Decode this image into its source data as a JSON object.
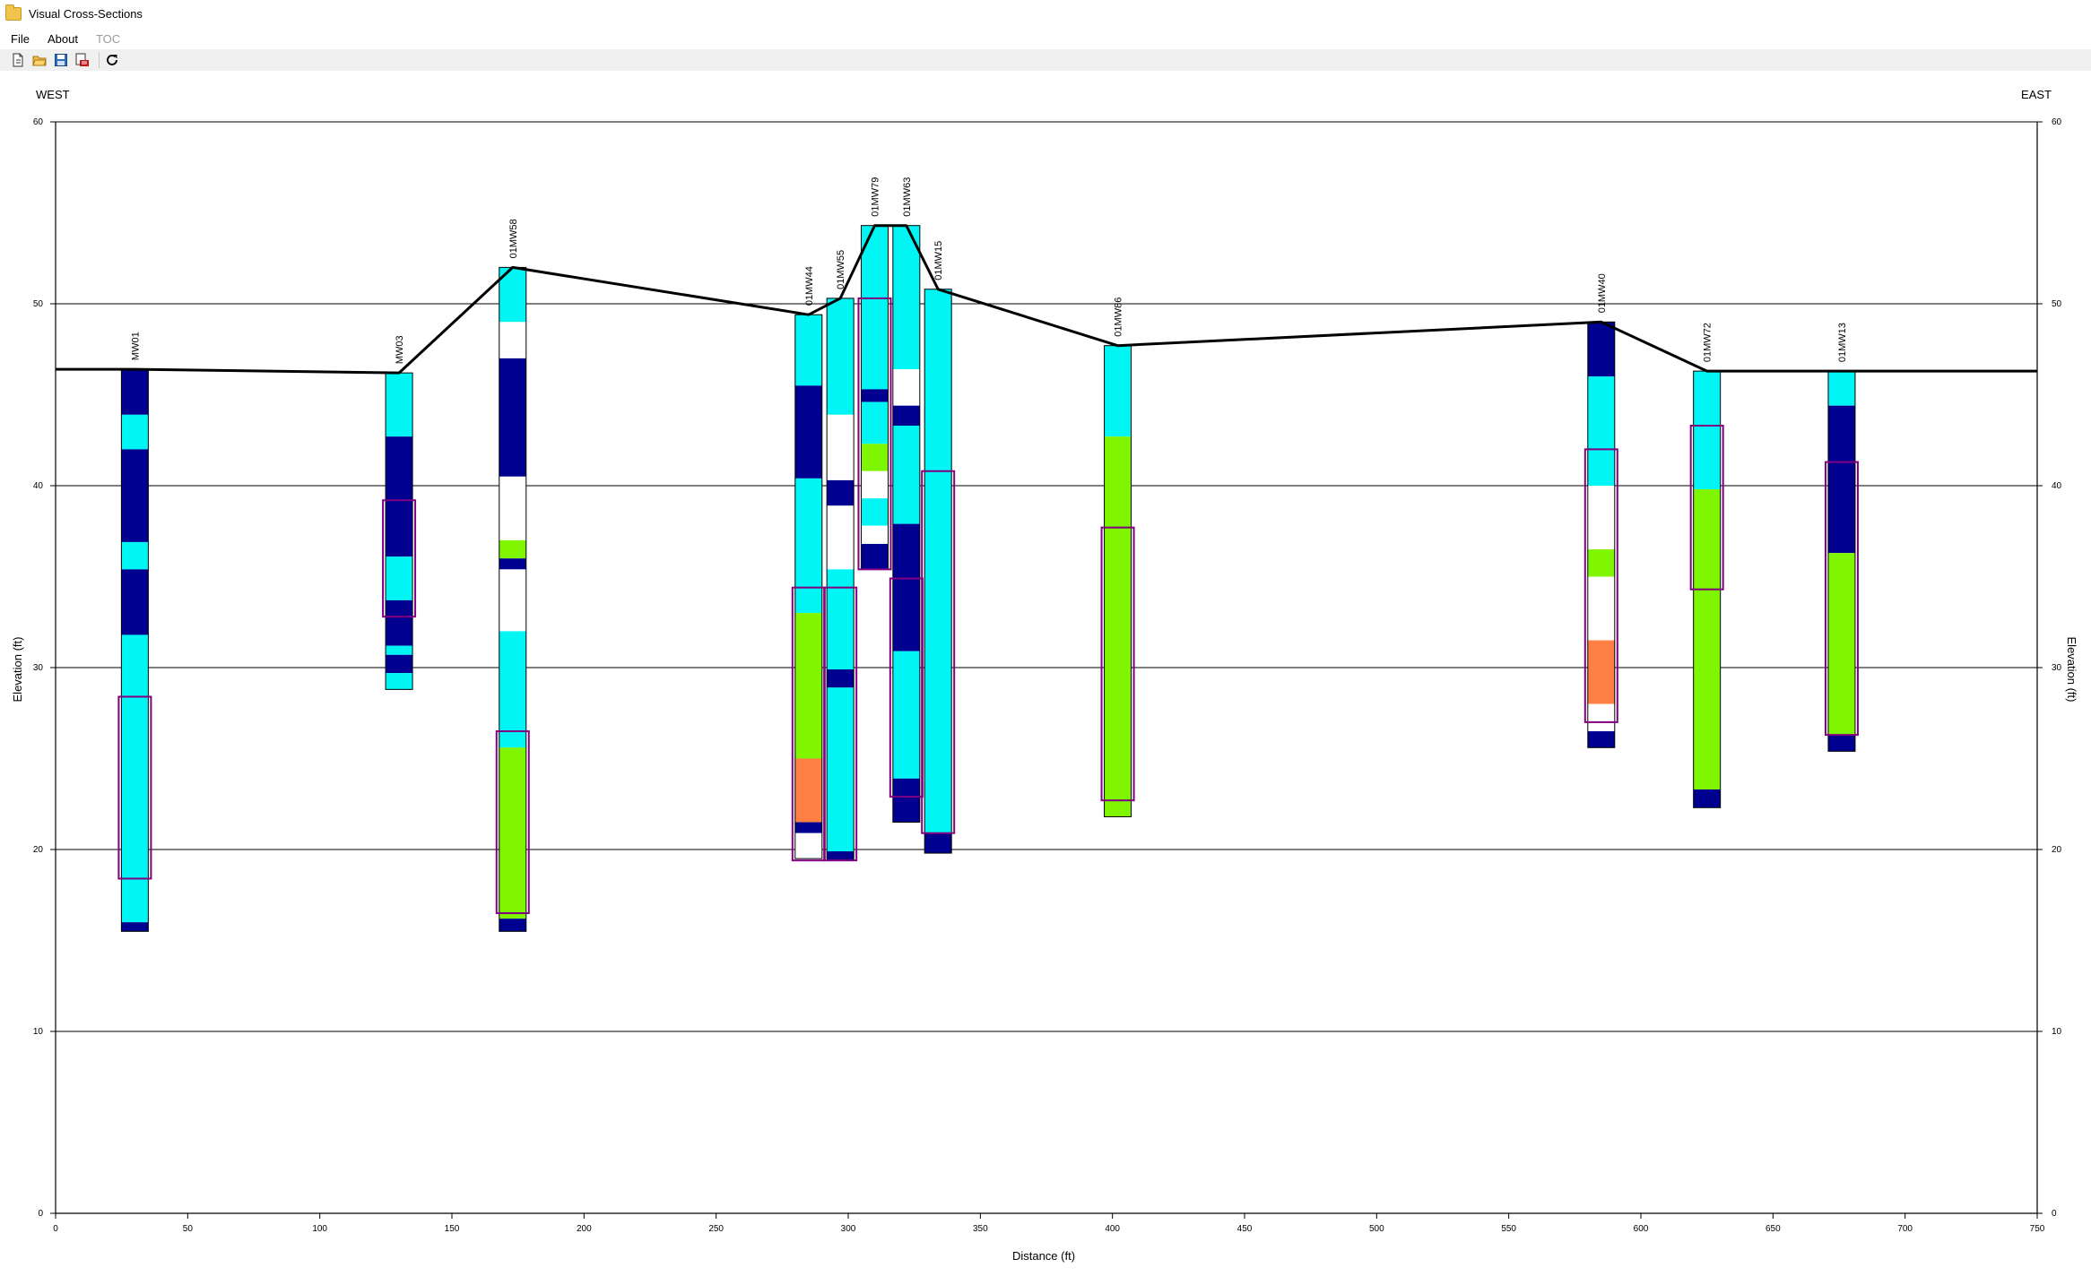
{
  "window": {
    "title": "Visual Cross-Sections"
  },
  "menu": {
    "file": "File",
    "about": "About",
    "toc": "TOC"
  },
  "toolbar": {
    "new_icon": "new-document-icon",
    "open_icon": "open-folder-icon",
    "save_icon": "save-icon",
    "pdf_icon": "pdf-export-icon",
    "refresh_icon": "refresh-icon"
  },
  "labels": {
    "west": "WEST",
    "east": "EAST"
  },
  "colors": {
    "cyan": "#00f5f5",
    "navy": "#000090",
    "green": "#7ff500",
    "orange": "#ff7f45",
    "white": "#ffffff",
    "screen": "#800080",
    "surface": "#000000"
  },
  "chart_data": {
    "type": "cross-section",
    "xlabel": "Distance (ft)",
    "ylabel": "Elevation (ft)",
    "ylabel_right": "Elevation (ft)",
    "xlim": [
      0,
      750
    ],
    "ylim": [
      0,
      60
    ],
    "xticks": [
      0,
      50,
      100,
      150,
      200,
      250,
      300,
      350,
      400,
      450,
      500,
      550,
      600,
      650,
      700,
      750
    ],
    "yticks": [
      0,
      10,
      20,
      30,
      40,
      50,
      60
    ],
    "grid": "horizontal",
    "surface": [
      [
        0,
        46.4
      ],
      [
        30,
        46.4
      ],
      [
        130,
        46.2
      ],
      [
        173,
        52
      ],
      [
        285,
        49.4
      ],
      [
        297,
        50.3
      ],
      [
        310,
        54.3
      ],
      [
        322,
        54.3
      ],
      [
        334,
        50.8
      ],
      [
        402,
        47.7
      ],
      [
        585,
        49
      ],
      [
        625,
        46.3
      ],
      [
        676,
        46.3
      ],
      [
        750,
        46.3
      ]
    ],
    "wells": [
      {
        "name": "MW01",
        "x": 30,
        "top": 46.4,
        "layers": [
          [
            46.4,
            43.9,
            "navy"
          ],
          [
            43.9,
            42,
            "cyan"
          ],
          [
            42,
            36.9,
            "navy"
          ],
          [
            36.9,
            35.4,
            "cyan"
          ],
          [
            35.4,
            31.8,
            "navy"
          ],
          [
            31.8,
            16,
            "cyan"
          ],
          [
            16,
            15.5,
            "navy"
          ]
        ],
        "screen": [
          28.4,
          18.4
        ]
      },
      {
        "name": "MW03",
        "x": 130,
        "top": 46.2,
        "layers": [
          [
            46.2,
            42.7,
            "cyan"
          ],
          [
            42.7,
            36.1,
            "navy"
          ],
          [
            36.1,
            33.7,
            "cyan"
          ],
          [
            33.7,
            31.2,
            "navy"
          ],
          [
            31.2,
            30.7,
            "cyan"
          ],
          [
            30.7,
            29.7,
            "navy"
          ],
          [
            29.7,
            28.8,
            "cyan"
          ]
        ],
        "screen": [
          39.2,
          32.8
        ]
      },
      {
        "name": "01MW58",
        "x": 173,
        "top": 52,
        "layers": [
          [
            52,
            49,
            "cyan"
          ],
          [
            49,
            47,
            "white"
          ],
          [
            47,
            40.5,
            "navy"
          ],
          [
            40.5,
            37,
            "white"
          ],
          [
            37,
            36,
            "green"
          ],
          [
            36,
            35.4,
            "navy"
          ],
          [
            35.4,
            32,
            "white"
          ],
          [
            32,
            25.6,
            "cyan"
          ],
          [
            25.6,
            16.2,
            "green"
          ],
          [
            16.2,
            15.5,
            "navy"
          ]
        ],
        "screen": [
          26.5,
          16.5
        ]
      },
      {
        "name": "01MW44",
        "x": 285,
        "top": 49.4,
        "layers": [
          [
            49.4,
            45.5,
            "cyan"
          ],
          [
            45.5,
            40.4,
            "navy"
          ],
          [
            40.4,
            33,
            "cyan"
          ],
          [
            33,
            25,
            "green"
          ],
          [
            25,
            21.5,
            "orange"
          ],
          [
            21.5,
            20.9,
            "navy"
          ],
          [
            20.9,
            19.5,
            "white"
          ]
        ],
        "screen": [
          34.4,
          19.4
        ]
      },
      {
        "name": "01MW55",
        "x": 297,
        "top": 50.3,
        "layers": [
          [
            50.3,
            43.9,
            "cyan"
          ],
          [
            43.9,
            40.3,
            "white"
          ],
          [
            40.3,
            38.9,
            "navy"
          ],
          [
            38.9,
            35.4,
            "white"
          ],
          [
            35.4,
            29.9,
            "cyan"
          ],
          [
            29.9,
            28.9,
            "navy"
          ],
          [
            28.9,
            19.9,
            "cyan"
          ],
          [
            19.9,
            19.4,
            "navy"
          ]
        ],
        "screen": [
          34.4,
          19.4
        ]
      },
      {
        "name": "01MW79",
        "x": 310,
        "top": 54.3,
        "layers": [
          [
            54.3,
            45.3,
            "cyan"
          ],
          [
            45.3,
            44.6,
            "navy"
          ],
          [
            44.6,
            42.3,
            "cyan"
          ],
          [
            42.3,
            40.8,
            "green"
          ],
          [
            40.8,
            39.3,
            "white"
          ],
          [
            39.3,
            37.8,
            "cyan"
          ],
          [
            37.8,
            36.8,
            "white"
          ],
          [
            36.8,
            35.4,
            "navy"
          ]
        ],
        "screen": [
          50.3,
          35.4
        ]
      },
      {
        "name": "01MW63",
        "x": 322,
        "top": 54.3,
        "layers": [
          [
            54.3,
            46.4,
            "cyan"
          ],
          [
            46.4,
            44.4,
            "white"
          ],
          [
            44.4,
            43.3,
            "navy"
          ],
          [
            43.3,
            37.9,
            "cyan"
          ],
          [
            37.9,
            30.9,
            "navy"
          ],
          [
            30.9,
            23.9,
            "cyan"
          ],
          [
            23.9,
            21.5,
            "navy"
          ]
        ],
        "screen": [
          34.9,
          22.9
        ]
      },
      {
        "name": "01MW15",
        "x": 334,
        "top": 50.8,
        "layers": [
          [
            50.8,
            20.9,
            "cyan"
          ],
          [
            20.9,
            19.8,
            "navy"
          ]
        ],
        "screen": [
          40.8,
          20.9
        ]
      },
      {
        "name": "01MW86",
        "x": 402,
        "top": 47.7,
        "layers": [
          [
            47.7,
            42.7,
            "cyan"
          ],
          [
            42.7,
            22.7,
            "green"
          ],
          [
            22.7,
            21.8,
            "green"
          ]
        ],
        "screen": [
          37.7,
          22.7
        ]
      },
      {
        "name": "01MW40",
        "x": 585,
        "top": 49,
        "layers": [
          [
            49,
            46,
            "navy"
          ],
          [
            46,
            40,
            "cyan"
          ],
          [
            40,
            36.5,
            "white"
          ],
          [
            36.5,
            35,
            "green"
          ],
          [
            35,
            31.5,
            "white"
          ],
          [
            31.5,
            28,
            "orange"
          ],
          [
            28,
            26.5,
            "white"
          ],
          [
            26.5,
            25.6,
            "navy"
          ]
        ],
        "screen": [
          42,
          27
        ]
      },
      {
        "name": "01MW72",
        "x": 625,
        "top": 46.3,
        "layers": [
          [
            46.3,
            43.3,
            "cyan"
          ],
          [
            43.3,
            39.8,
            "cyan"
          ],
          [
            39.8,
            23.3,
            "green"
          ],
          [
            23.3,
            22.3,
            "navy"
          ]
        ],
        "screen": [
          43.3,
          34.3
        ]
      },
      {
        "name": "01MW13",
        "x": 676,
        "top": 46.3,
        "layers": [
          [
            46.3,
            44.4,
            "cyan"
          ],
          [
            44.4,
            36.3,
            "navy"
          ],
          [
            36.3,
            26.3,
            "green"
          ],
          [
            26.3,
            25.4,
            "navy"
          ]
        ],
        "screen": [
          41.3,
          26.3
        ]
      }
    ]
  }
}
